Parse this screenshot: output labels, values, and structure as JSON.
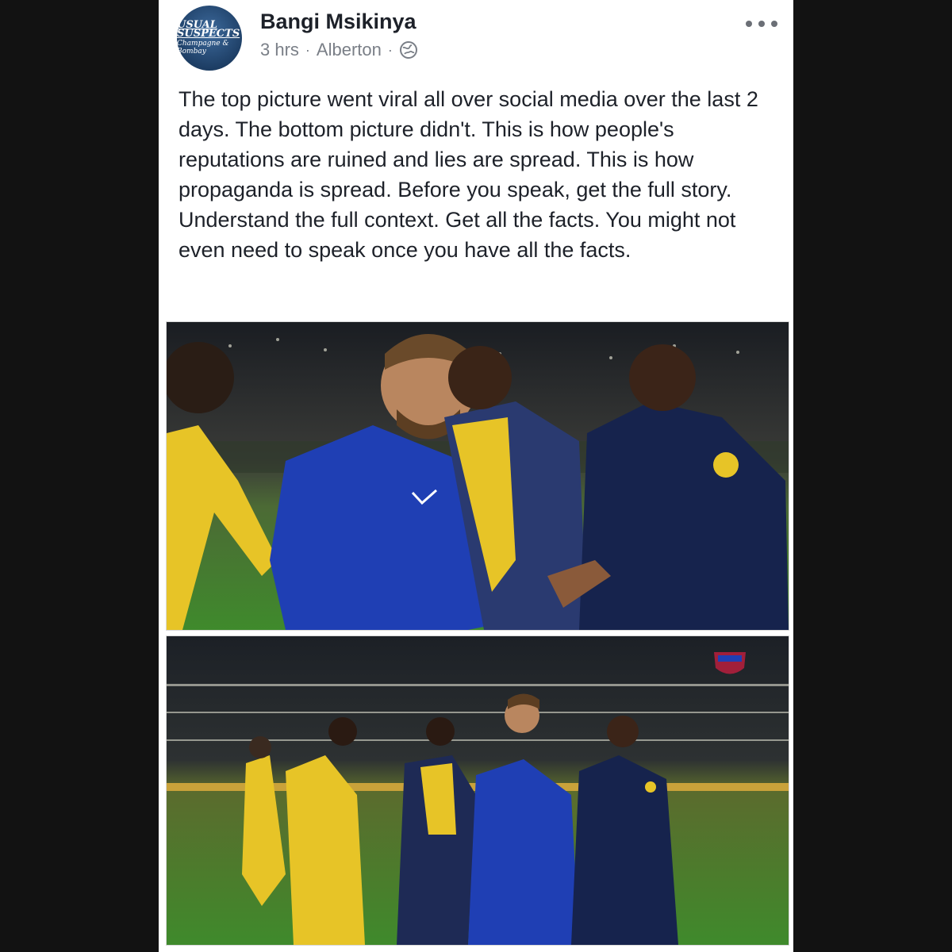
{
  "post": {
    "author": "Bangi Msikinya",
    "avatar": {
      "line1": "USUAL SUSPECTS",
      "line2": "Champagne & Bombay",
      "line3": "Bombay"
    },
    "time": "3 hrs",
    "separator": "·",
    "location": "Alberton",
    "privacy_icon": "globe-icon",
    "menu_icon": "more-options-icon",
    "text": "The top picture went viral all over social media over the last 2 days. The bottom picture didn't. This is how people's reputations are ruined and lies are spread. This is how propaganda is spread. Before you speak, get the full story. Understand the full context. Get all the facts. You might not even need to speak once you have all the facts."
  },
  "colors": {
    "page_background": "#121212",
    "card_background": "#ffffff",
    "author_text": "#1d2129",
    "meta_text": "#7a7f87",
    "pitch_green": "#3f8a2c",
    "jersey_blue": "#1f3fb4",
    "jersey_yellow": "#e7c427",
    "jacket_navy": "#16234d"
  }
}
